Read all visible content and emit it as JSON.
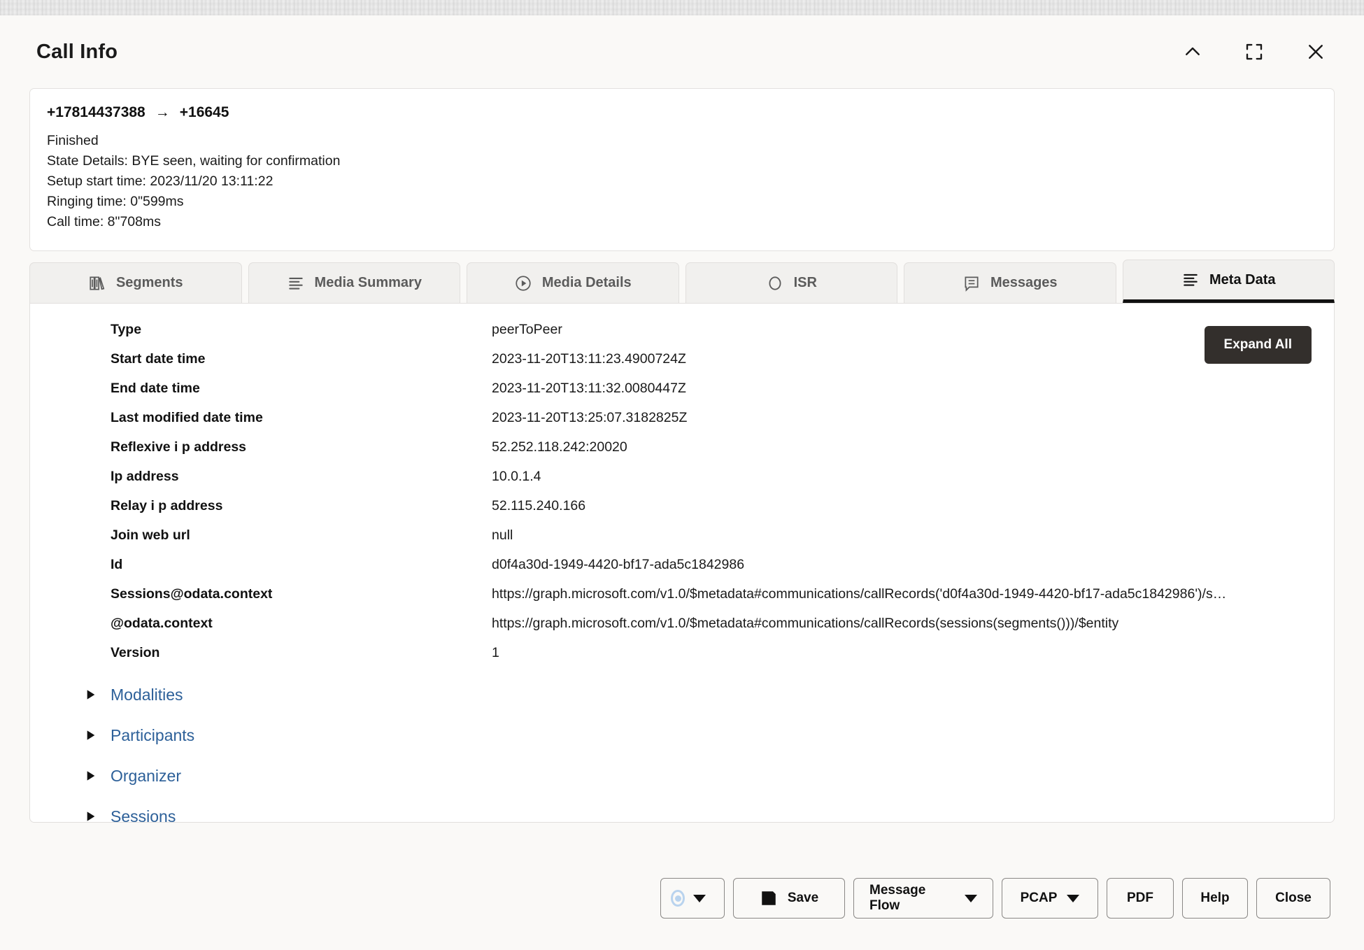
{
  "header": {
    "title": "Call Info",
    "controls": [
      {
        "name": "collapse-icon",
        "label": "Collapse"
      },
      {
        "name": "fullscreen-icon",
        "label": "Fullscreen"
      },
      {
        "name": "close-icon",
        "label": "Close"
      }
    ]
  },
  "call_summary": {
    "from": "+17814437388",
    "arrow": "→",
    "to": "+16645",
    "status": "Finished",
    "state_details": "State Details: BYE seen, waiting for confirmation",
    "setup_start_time": "Setup start time: 2023/11/20 13:11:22",
    "ringing_time": "Ringing time: 0\"599ms",
    "call_time": "Call time: 8\"708ms"
  },
  "tabs": [
    {
      "label": "Segments",
      "icon": "books-icon",
      "active": false
    },
    {
      "label": "Media Summary",
      "icon": "list-icon",
      "active": false
    },
    {
      "label": "Media Details",
      "icon": "play-icon",
      "active": false
    },
    {
      "label": "ISR",
      "icon": "circle-icon",
      "active": false
    },
    {
      "label": "Messages",
      "icon": "message-icon",
      "active": false
    },
    {
      "label": "Meta Data",
      "icon": "list-icon",
      "active": true
    }
  ],
  "content": {
    "expand_all_label": "Expand All",
    "rows": [
      {
        "key": "Type",
        "value": "peerToPeer"
      },
      {
        "key": "Start date time",
        "value": "2023-11-20T13:11:23.4900724Z"
      },
      {
        "key": "End date time",
        "value": "2023-11-20T13:11:32.0080447Z"
      },
      {
        "key": "Last modified date time",
        "value": "2023-11-20T13:25:07.3182825Z"
      },
      {
        "key": "Reflexive i p address",
        "value": "52.252.118.242:20020"
      },
      {
        "key": "Ip address",
        "value": "10.0.1.4"
      },
      {
        "key": "Relay i p address",
        "value": "52.115.240.166"
      },
      {
        "key": "Join web url",
        "value": "null"
      },
      {
        "key": "Id",
        "value": "d0f4a30d-1949-4420-bf17-ada5c1842986"
      },
      {
        "key": "Sessions@odata.context",
        "value": "https://graph.microsoft.com/v1.0/$metadata#communications/callRecords('d0f4a30d-1949-4420-bf17-ada5c1842986')/s…"
      },
      {
        "key": "@odata.context",
        "value": "https://graph.microsoft.com/v1.0/$metadata#communications/callRecords(sessions(segments()))/$entity"
      },
      {
        "key": "Version",
        "value": "1"
      }
    ],
    "expandables": [
      {
        "label": "Modalities"
      },
      {
        "label": "Participants"
      },
      {
        "label": "Organizer"
      },
      {
        "label": "Sessions"
      }
    ]
  },
  "footer": {
    "record_label": "",
    "save_label": "Save",
    "message_flow_label": "Message Flow",
    "pcap_label": "PCAP",
    "pdf_label": "PDF",
    "help_label": "Help",
    "close_label": "Close"
  },
  "colors": {
    "accent_link": "#2d6099",
    "dark_button": "#332f2c",
    "tab_active_underline": "#111111",
    "panel_bg": "#ffffff",
    "app_bg": "#faf9f7"
  }
}
